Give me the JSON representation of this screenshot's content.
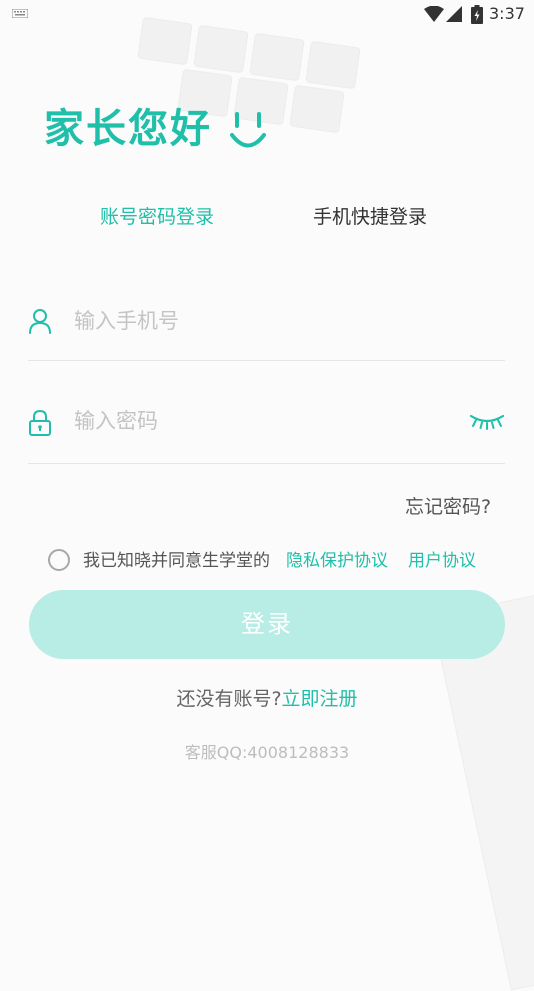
{
  "status_bar": {
    "time": "3:37"
  },
  "header": {
    "greeting": "家长您好",
    "smile_icon": "smile-icon"
  },
  "tabs": [
    {
      "label": "账号密码登录",
      "active": true
    },
    {
      "label": "手机快捷登录",
      "active": false
    }
  ],
  "form": {
    "phone": {
      "placeholder": "输入手机号",
      "value": "",
      "icon": "user-icon"
    },
    "password": {
      "placeholder": "输入密码",
      "value": "",
      "icon": "lock-icon",
      "toggle_icon": "eye-closed-icon"
    },
    "forgot_label": "忘记密码?",
    "agreement": {
      "checked": false,
      "text": "我已知晓并同意生学堂的",
      "privacy_link": "隐私保护协议",
      "user_link": "用户协议"
    },
    "login_label": "登录"
  },
  "register": {
    "prompt": "还没有账号?",
    "link": "立即注册"
  },
  "service": {
    "text": "客服QQ:4008128833"
  },
  "colors": {
    "accent": "#1fbfa9",
    "button_disabled": "#b8ede5",
    "placeholder": "#c4c4c4"
  }
}
